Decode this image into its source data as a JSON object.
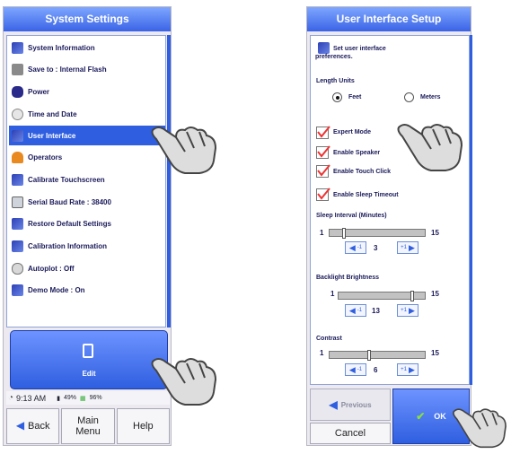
{
  "left": {
    "title": "System Settings",
    "items": [
      {
        "label": "System Information",
        "icon": "book-icon"
      },
      {
        "label": "Save to : Internal Flash",
        "icon": "disk-icon"
      },
      {
        "label": "Power",
        "icon": "power-icon"
      },
      {
        "label": "Time and Date",
        "icon": "clock-icon"
      },
      {
        "label": "User Interface",
        "icon": "book-icon",
        "selected": true
      },
      {
        "label": "Operators",
        "icon": "operator-icon"
      },
      {
        "label": "Calibrate Touchscreen",
        "icon": "book-icon"
      },
      {
        "label": "Serial Baud Rate : 38400",
        "icon": "serial-icon"
      },
      {
        "label": "Restore Default Settings",
        "icon": "book-icon"
      },
      {
        "label": "Calibration Information",
        "icon": "book-icon"
      },
      {
        "label": "Autoplot : Off",
        "icon": "autoplot-icon"
      },
      {
        "label": "Demo Mode : On",
        "icon": "book-icon"
      }
    ],
    "edit_label": "Edit",
    "status": {
      "time": "9:13 AM",
      "battery": "49%",
      "memory": "96%"
    },
    "buttons": {
      "back": "Back",
      "main_menu": "Main Menu",
      "help": "Help"
    }
  },
  "right": {
    "title": "User Interface Setup",
    "intro": "Set user interface preferences.",
    "length_units": {
      "label": "Length Units",
      "options": [
        "Feet",
        "Meters"
      ],
      "selected": "Feet"
    },
    "checks": [
      {
        "label": "Expert Mode",
        "checked": true
      },
      {
        "label": "Enable Speaker",
        "checked": true
      },
      {
        "label": "Enable Touch Click",
        "checked": true
      },
      {
        "label": "Enable Sleep Timeout",
        "checked": true
      }
    ],
    "sliders": [
      {
        "label": "Sleep Interval (Minutes)",
        "min": "1",
        "max": "15",
        "value": "3"
      },
      {
        "label": "Backlight Brightness",
        "min": "1",
        "max": "15",
        "value": "13"
      },
      {
        "label": "Contrast",
        "min": "1",
        "max": "15",
        "value": "6"
      }
    ],
    "step_minus": "-1",
    "step_plus": "+1",
    "buttons": {
      "previous": "Previous",
      "cancel": "Cancel",
      "ok": "OK"
    }
  },
  "colors": {
    "accent": "#2f5fe0",
    "title_bar": "#3a63e6"
  }
}
